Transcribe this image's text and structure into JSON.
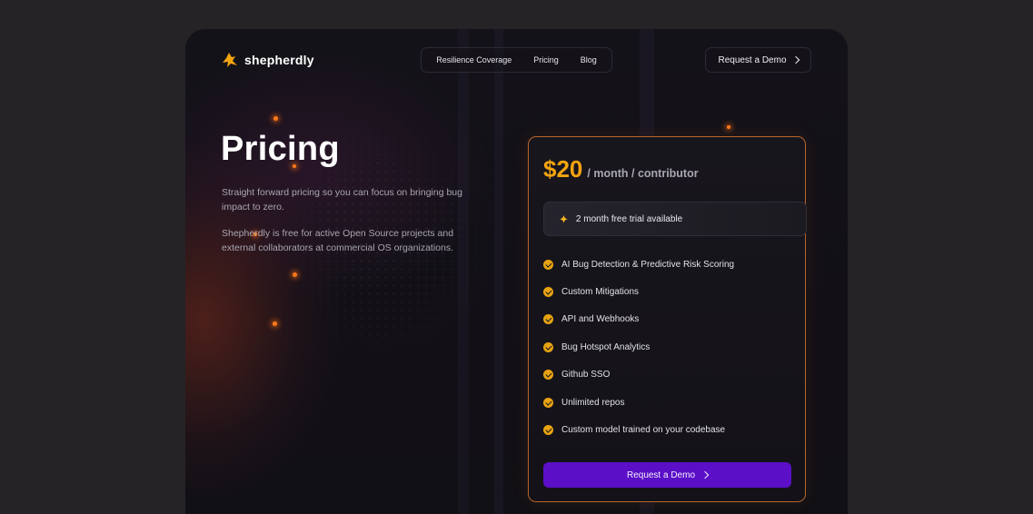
{
  "brand": {
    "name": "shepherdly",
    "logo_icon": "shepherd-logo-icon",
    "accent": "#f4a410"
  },
  "nav": {
    "items": [
      {
        "label": "Resilience Coverage"
      },
      {
        "label": "Pricing"
      },
      {
        "label": "Blog"
      }
    ],
    "demo_button": "Request a Demo"
  },
  "hero": {
    "title": "Pricing",
    "paragraph1": "Straight forward pricing so you can focus on bringing bug impact to zero.",
    "paragraph2": "Shepherdly is free for active Open Source projects and external collaborators at commercial OS organizations."
  },
  "plan": {
    "price": "$20",
    "unit": "/ month / contributor",
    "trial": "2 month free trial available",
    "features": [
      "AI Bug Detection & Predictive Risk Scoring",
      "Custom Mitigations",
      "API and Webhooks",
      "Bug Hotspot Analytics",
      "Github SSO",
      "Unlimited repos",
      "Custom model trained on your codebase"
    ],
    "cta": "Request a Demo",
    "cta_color": "#5b0fc7"
  }
}
